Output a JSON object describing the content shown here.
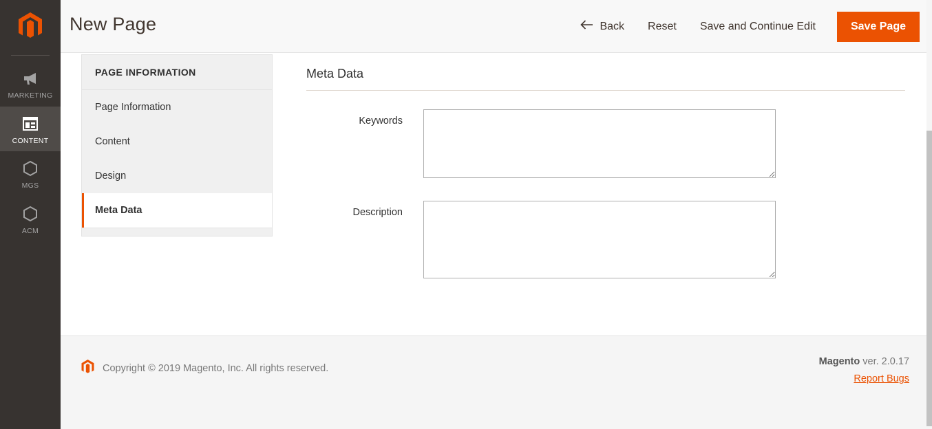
{
  "colors": {
    "brand_orange": "#eb5202",
    "sidebar_bg": "#373330",
    "sidebar_active_bg": "#4f4b48",
    "header_bg": "#f8f8f8",
    "footer_bg": "#f5f5f5",
    "text_dark": "#303030"
  },
  "sidebar": {
    "logo_name": "magento-logo-icon",
    "items": [
      {
        "label": "MARKETING",
        "icon": "megaphone-icon",
        "active": false
      },
      {
        "label": "CONTENT",
        "icon": "content-layout-icon",
        "active": true
      },
      {
        "label": "MGS",
        "icon": "hexagon-icon",
        "active": false
      },
      {
        "label": "ACM",
        "icon": "hexagon-icon",
        "active": false
      }
    ]
  },
  "header": {
    "title": "New Page",
    "actions": {
      "back": "Back",
      "back_icon": "arrow-left-icon",
      "reset": "Reset",
      "save_and_continue": "Save and Continue Edit",
      "save_page": "Save Page"
    }
  },
  "tab_panel": {
    "heading": "PAGE INFORMATION",
    "items": [
      {
        "label": "Page Information",
        "active": false
      },
      {
        "label": "Content",
        "active": false
      },
      {
        "label": "Design",
        "active": false
      },
      {
        "label": "Meta Data",
        "active": true
      }
    ]
  },
  "form": {
    "section_title": "Meta Data",
    "fields": [
      {
        "label": "Keywords",
        "value": "",
        "placeholder": ""
      },
      {
        "label": "Description",
        "value": "",
        "placeholder": ""
      }
    ]
  },
  "footer": {
    "logo_name": "magento-logo-icon",
    "copyright": "Copyright © 2019 Magento, Inc. All rights reserved.",
    "brand": "Magento",
    "version": " ver. 2.0.17",
    "report_bugs": "Report Bugs"
  }
}
